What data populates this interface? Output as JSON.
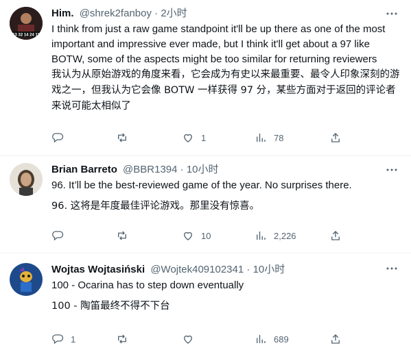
{
  "tweets": [
    {
      "display_name": "Him.",
      "handle": "@shrek2fanboy",
      "separator": "·",
      "time": "2小时",
      "text_en": "I think from just a raw game standpoint it'll be up there as one of the most important and impressive ever made, but I think it'll get about a 97 like BOTW, some of the aspects might be too similar for returning reviewers",
      "text_cn": "我认为从原始游戏的角度来看，它会成为有史以来最重要、最令人印象深刻的游戏之一，但我认为它会像 BOTW 一样获得 97 分，某些方面对于返回的评论者来说可能太相似了",
      "replies": "",
      "retweets": "",
      "likes": "1",
      "views": "78"
    },
    {
      "display_name": "Brian Barreto",
      "handle": "@BBR1394",
      "separator": "·",
      "time": "10小时",
      "text_en": "96.  It’ll be the best-reviewed game of the year.  No surprises there.",
      "text_cn": "96. 这将是年度最佳评论游戏。那里没有惊喜。",
      "replies": "",
      "retweets": "",
      "likes": "10",
      "views": "2,226"
    },
    {
      "display_name": "Wojtas Wojtasiński",
      "handle": "@Wojtek409102341",
      "separator": "·",
      "time": "10小时",
      "text_en": "100 - Ocarina has to step down eventually",
      "text_cn": "100 - 陶笛最终不得不下台",
      "replies": "1",
      "retweets": "",
      "likes": "",
      "views": "689"
    }
  ],
  "icons": {
    "more": "more-icon",
    "reply": "reply-icon",
    "retweet": "retweet-icon",
    "like": "like-icon",
    "views": "views-icon",
    "share": "share-icon"
  },
  "colors": {
    "text": "#0f1419",
    "secondary": "#536471",
    "divider": "#eff3f4"
  }
}
